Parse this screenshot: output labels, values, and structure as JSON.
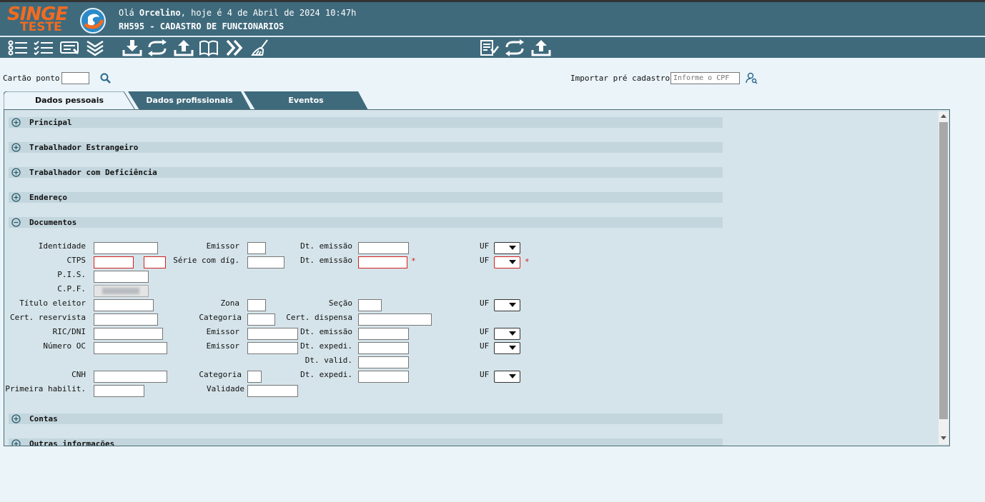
{
  "header": {
    "logo_line1": "SINGE",
    "logo_line2": "TESTE",
    "greeting_prefix": "Olá ",
    "user": "Orcelino",
    "greeting_suffix": ", hoje é 4 de Abril de 2024 10:47h",
    "screen_title": "RH595 - CADASTRO DE FUNCIONARIOS"
  },
  "colors": {
    "header_bg": "#3f6a7c",
    "logo": "#f36b1f",
    "required": "#d42020",
    "panel_bg": "#d5e4ea"
  },
  "top": {
    "cartao_ponto_label": "Cartão ponto",
    "importar_label": "Importar pré cadastro",
    "cpf_placeholder": "Informe o CPF"
  },
  "tabs": [
    "Dados pessoais",
    "Dados profissionais",
    "Eventos"
  ],
  "sections": {
    "principal": "Principal",
    "estrangeiro": "Trabalhador Estrangeiro",
    "deficiencia": "Trabalhador com Deficiência",
    "endereco": "Endereço",
    "documentos": "Documentos",
    "contas": "Contas",
    "outras": "Outras informações"
  },
  "fields": {
    "identidade": "Identidade",
    "emissor": "Emissor",
    "dt_emissao": "Dt. emissão",
    "uf": "UF",
    "ctps": "CTPS",
    "serie": "Série com díg.",
    "pis": "P.I.S.",
    "cpf": "C.P.F.",
    "titulo": "Título eleitor",
    "zona": "Zona",
    "secao": "Seção",
    "reservista": "Cert. reservista",
    "categoria": "Categoria",
    "dispensa": "Cert. dispensa",
    "ric": "RIC/DNI",
    "numero_oc": "Número OC",
    "dt_expedi": "Dt. expedi.",
    "dt_valid": "Dt. valid.",
    "cnh": "CNH",
    "primeira": "Primeira habilit.",
    "validade": "Validade",
    "required_mark": "*"
  }
}
